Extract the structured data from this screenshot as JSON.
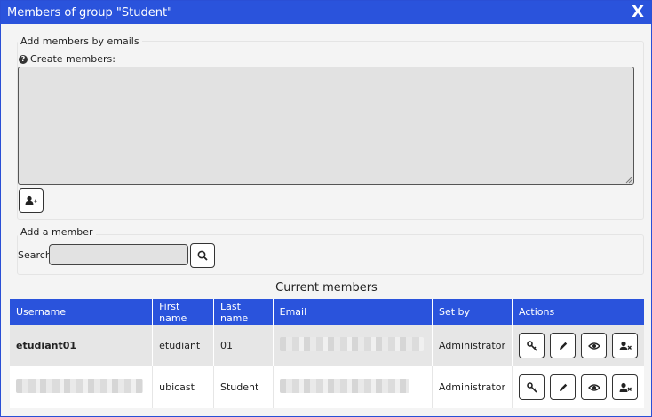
{
  "dialog": {
    "title": "Members of group \"Student\"",
    "close_label": "X"
  },
  "emails_section": {
    "legend": "Add members by emails",
    "create_label": "Create members:",
    "textarea_value": "",
    "icons": {
      "help": "question-circle-icon",
      "add": "user-plus-icon"
    }
  },
  "member_section": {
    "legend": "Add a member",
    "search_label": "Search",
    "search_value": ""
  },
  "table": {
    "title": "Current members",
    "headers": [
      "Username",
      "First name",
      "Last name",
      "Email",
      "Set by",
      "Actions"
    ],
    "rows": [
      {
        "username": "etudiant01",
        "first_name": "etudiant",
        "last_name": "01",
        "email": "",
        "set_by": "Administrator"
      },
      {
        "username": "",
        "first_name": "ubicast",
        "last_name": "Student",
        "email": "",
        "set_by": "Administrator"
      }
    ],
    "action_icons": [
      "key-icon",
      "pencil-icon",
      "eye-icon",
      "user-remove-icon"
    ]
  },
  "colors": {
    "accent": "#2a53dc",
    "background": "#f4f4f4",
    "row_alt": "#e6e6e6"
  }
}
